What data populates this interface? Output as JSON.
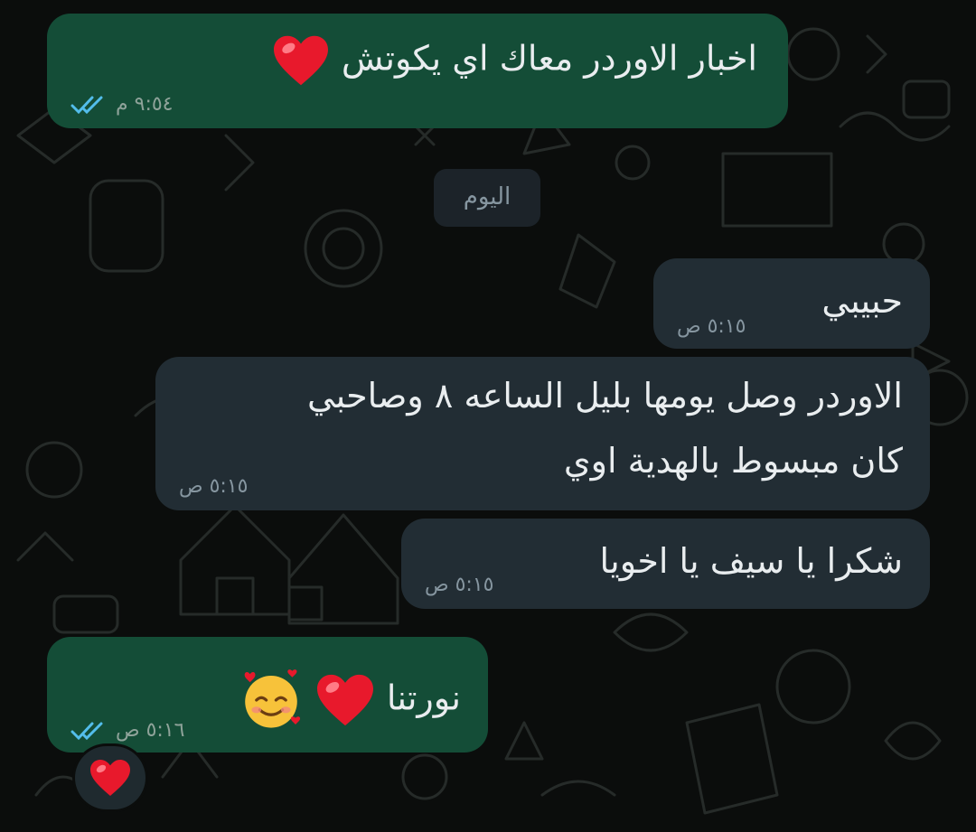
{
  "chat": {
    "date_separator": "اليوم",
    "messages": [
      {
        "direction": "outgoing",
        "text": "اخبار الاوردر معاك اي يكوتش",
        "emoji": [
          "red-heart"
        ],
        "time": "٩:٥٤ م",
        "read": true
      },
      {
        "direction": "incoming",
        "text": "حبيبي",
        "time": "٥:١٥ ص"
      },
      {
        "direction": "incoming",
        "lines": [
          "الاوردر وصل يومها بليل الساعه ٨ وصاحبي",
          "كان مبسوط بالهدية اوي"
        ],
        "time": "٥:١٥ ص"
      },
      {
        "direction": "incoming",
        "text": "شكرا يا سيف يا اخويا",
        "time": "٥:١٥ ص"
      },
      {
        "direction": "outgoing",
        "text": "نورتنا",
        "emoji": [
          "red-heart",
          "smiling-face-with-hearts"
        ],
        "time": "٥:١٦ ص",
        "read": true,
        "reaction": "red-heart"
      }
    ]
  },
  "colors": {
    "background": "#0b0d0c",
    "outgoing_bubble": "#144d37",
    "incoming_bubble": "#222d34",
    "read_ticks": "#53bdeb",
    "heart": "#e8192c"
  }
}
